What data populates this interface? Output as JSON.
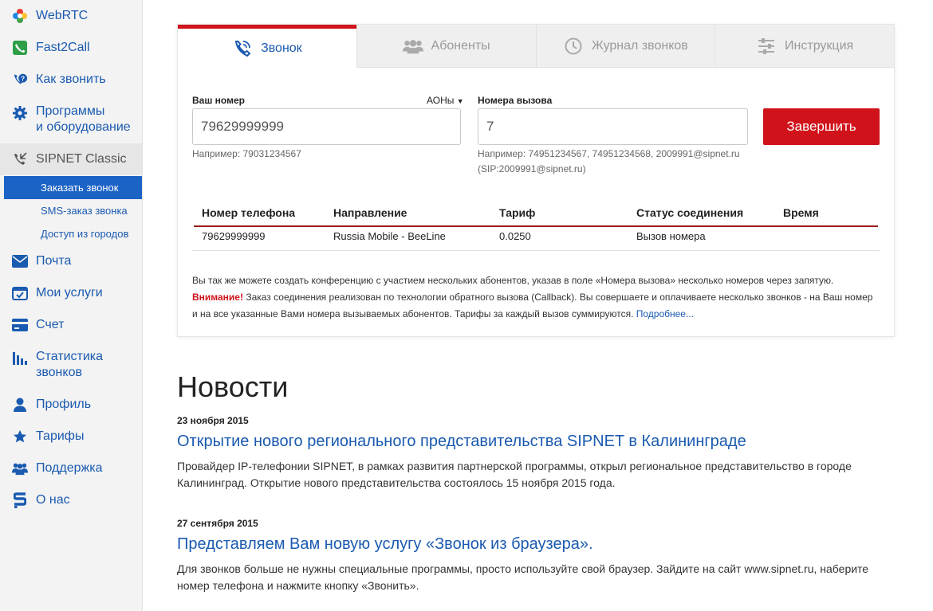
{
  "sidebar": {
    "items": [
      {
        "label": "WebRTC",
        "icon": "webrtc-icon"
      },
      {
        "label": "Fast2Call",
        "icon": "phone-square-icon"
      },
      {
        "label": "Как звонить",
        "icon": "phone-question-icon"
      },
      {
        "label": "Программы\nи оборудование",
        "label_line1": "Программы",
        "label_line2": "и оборудование",
        "icon": "gear-icon"
      },
      {
        "label": "SIPNET Classic",
        "icon": "phone-incoming-icon"
      },
      {
        "label": "Почта",
        "icon": "envelope-icon"
      },
      {
        "label": "Мои услуги",
        "icon": "calendar-icon"
      },
      {
        "label": "Счет",
        "icon": "credit-card-icon"
      },
      {
        "label_line1": "Статистика",
        "label_line2": "звонков",
        "icon": "bar-chart-icon"
      },
      {
        "label": "Профиль",
        "icon": "user-icon"
      },
      {
        "label": "Тарифы",
        "icon": "star-icon"
      },
      {
        "label": "Поддержка",
        "icon": "users-icon"
      },
      {
        "label": "О нас",
        "icon": "sipnet-logo-icon"
      }
    ],
    "sub_items": [
      "Заказать звонок",
      "SMS-заказ звонка",
      "Доступ из городов"
    ]
  },
  "tabs": [
    {
      "label": "Звонок",
      "icon": "phone-icon",
      "active": true
    },
    {
      "label": "Абоненты",
      "icon": "group-icon",
      "active": false
    },
    {
      "label": "Журнал звонков",
      "icon": "clock-icon",
      "active": false
    },
    {
      "label": "Инструкция",
      "icon": "sliders-icon",
      "active": false
    }
  ],
  "form": {
    "your_number_label": "Ваш номер",
    "aon_label": "АОНы",
    "your_number_value": "79629999999",
    "your_number_hint": "Например: 79031234567",
    "call_numbers_label": "Номера вызова",
    "call_numbers_value": "7",
    "call_numbers_hint_line1": "Например: 74951234567, 74951234568, 2009991@sipnet.ru",
    "call_numbers_hint_line2": "(SIP:2009991@sipnet.ru)",
    "end_button": "Завершить"
  },
  "table": {
    "headers": [
      "Номер телефона",
      "Направление",
      "Тариф",
      "Статус соединения",
      "Время"
    ],
    "rows": [
      [
        "79629999999",
        "Russia Mobile - BeeLine",
        "0.0250",
        "Вызов номера",
        ""
      ]
    ]
  },
  "note": {
    "line1": "Вы так же можете создать конференцию с участием нескольких абонентов, указав в поле «Номера вызова» несколько номеров через запятую.",
    "warning": "Внимание!",
    "line2": " Заказ соединения реализован по технологии обратного вызова (Callback). Вы совершаете и оплачиваете несколько звонков - на Ваш номер и на все указанные Вами номера вызываемых абонентов. Тарифы за каждый вызов суммируются. ",
    "more_link": "Подробнее..."
  },
  "news": {
    "heading": "Новости",
    "items": [
      {
        "date": "23 ноября 2015",
        "title": "Открытие нового регионального представительства SIPNET в Калининграде",
        "text": "Провайдер IP-телефонии SIPNET, в рамках развития партнерской программы, открыл региональное представительство в городе Калининград. Открытие нового представительства состоялось 15 ноября 2015 года."
      },
      {
        "date": "27 сентября 2015",
        "title": "Представляем Вам новую услугу «Звонок из браузера».",
        "text": "Для звонков больше не нужны специальные программы, просто используйте свой браузер. Зайдите на сайт www.sipnet.ru, наберите номер телефона и нажмите кнопку «Звонить»."
      }
    ]
  },
  "colors": {
    "link_blue": "#1a5ab0",
    "accent_red": "#d0131a",
    "sidebar_active": "#1c63c6"
  }
}
